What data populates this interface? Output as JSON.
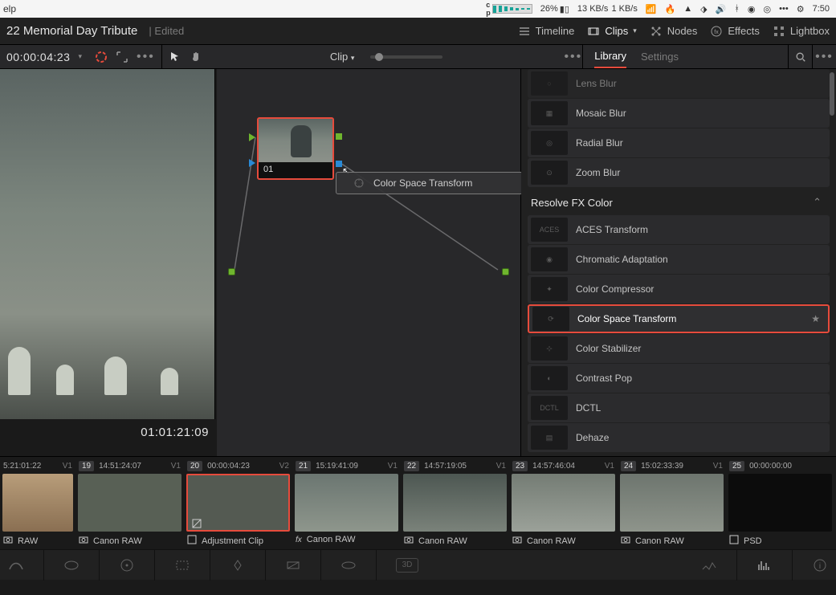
{
  "menubar": {
    "help": "elp",
    "battery_pct": "26%",
    "net_down": "13 KB/s",
    "net_up": "1 KB/s",
    "clock": "7:50"
  },
  "project": {
    "title": "22 Memorial Day Tribute",
    "status": "Edited"
  },
  "top_tabs": {
    "timeline": "Timeline",
    "clips": "Clips",
    "nodes": "Nodes",
    "effects": "Effects",
    "lightbox": "Lightbox"
  },
  "toolbar": {
    "record_tc": "00:00:04:23",
    "clip_mode": "Clip"
  },
  "library_tabs": {
    "library": "Library",
    "settings": "Settings"
  },
  "viewer": {
    "source_tc": "01:01:21:09"
  },
  "nodes": {
    "node01_label": "01",
    "drag_fx_name": "Color Space Transform"
  },
  "fx": {
    "blur": [
      {
        "name": "Lens Blur"
      },
      {
        "name": "Mosaic Blur"
      },
      {
        "name": "Radial Blur"
      },
      {
        "name": "Zoom Blur"
      }
    ],
    "color_cat": "Resolve FX Color",
    "color": [
      {
        "name": "ACES Transform",
        "thumb": "ACES"
      },
      {
        "name": "Chromatic Adaptation",
        "thumb": ""
      },
      {
        "name": "Color Compressor",
        "thumb": ""
      },
      {
        "name": "Color Space Transform",
        "thumb": "",
        "selected": true
      },
      {
        "name": "Color Stabilizer",
        "thumb": ""
      },
      {
        "name": "Contrast Pop",
        "thumb": ""
      },
      {
        "name": "DCTL",
        "thumb": "DCTL"
      },
      {
        "name": "Dehaze",
        "thumb": ""
      }
    ]
  },
  "clips": [
    {
      "num": "",
      "tc": "5:21:01:22",
      "track": "V1",
      "name": "RAW",
      "codec": ""
    },
    {
      "num": "19",
      "tc": "14:51:24:07",
      "track": "V1",
      "name": "Canon RAW",
      "codec": ""
    },
    {
      "num": "20",
      "tc": "00:00:04:23",
      "track": "V2",
      "name": "Adjustment Clip",
      "codec": "",
      "selected": true,
      "adj": true
    },
    {
      "num": "21",
      "tc": "15:19:41:09",
      "track": "V1",
      "name": "Canon RAW",
      "codec": "fx"
    },
    {
      "num": "22",
      "tc": "14:57:19:05",
      "track": "V1",
      "name": "Canon RAW",
      "codec": ""
    },
    {
      "num": "23",
      "tc": "14:57:46:04",
      "track": "V1",
      "name": "Canon RAW",
      "codec": ""
    },
    {
      "num": "24",
      "tc": "15:02:33:39",
      "track": "V1",
      "name": "Canon RAW",
      "codec": ""
    },
    {
      "num": "25",
      "tc": "00:00:00:00",
      "track": "",
      "name": "PSD",
      "codec": ""
    }
  ],
  "bottom": {
    "btn3d": "3D"
  }
}
